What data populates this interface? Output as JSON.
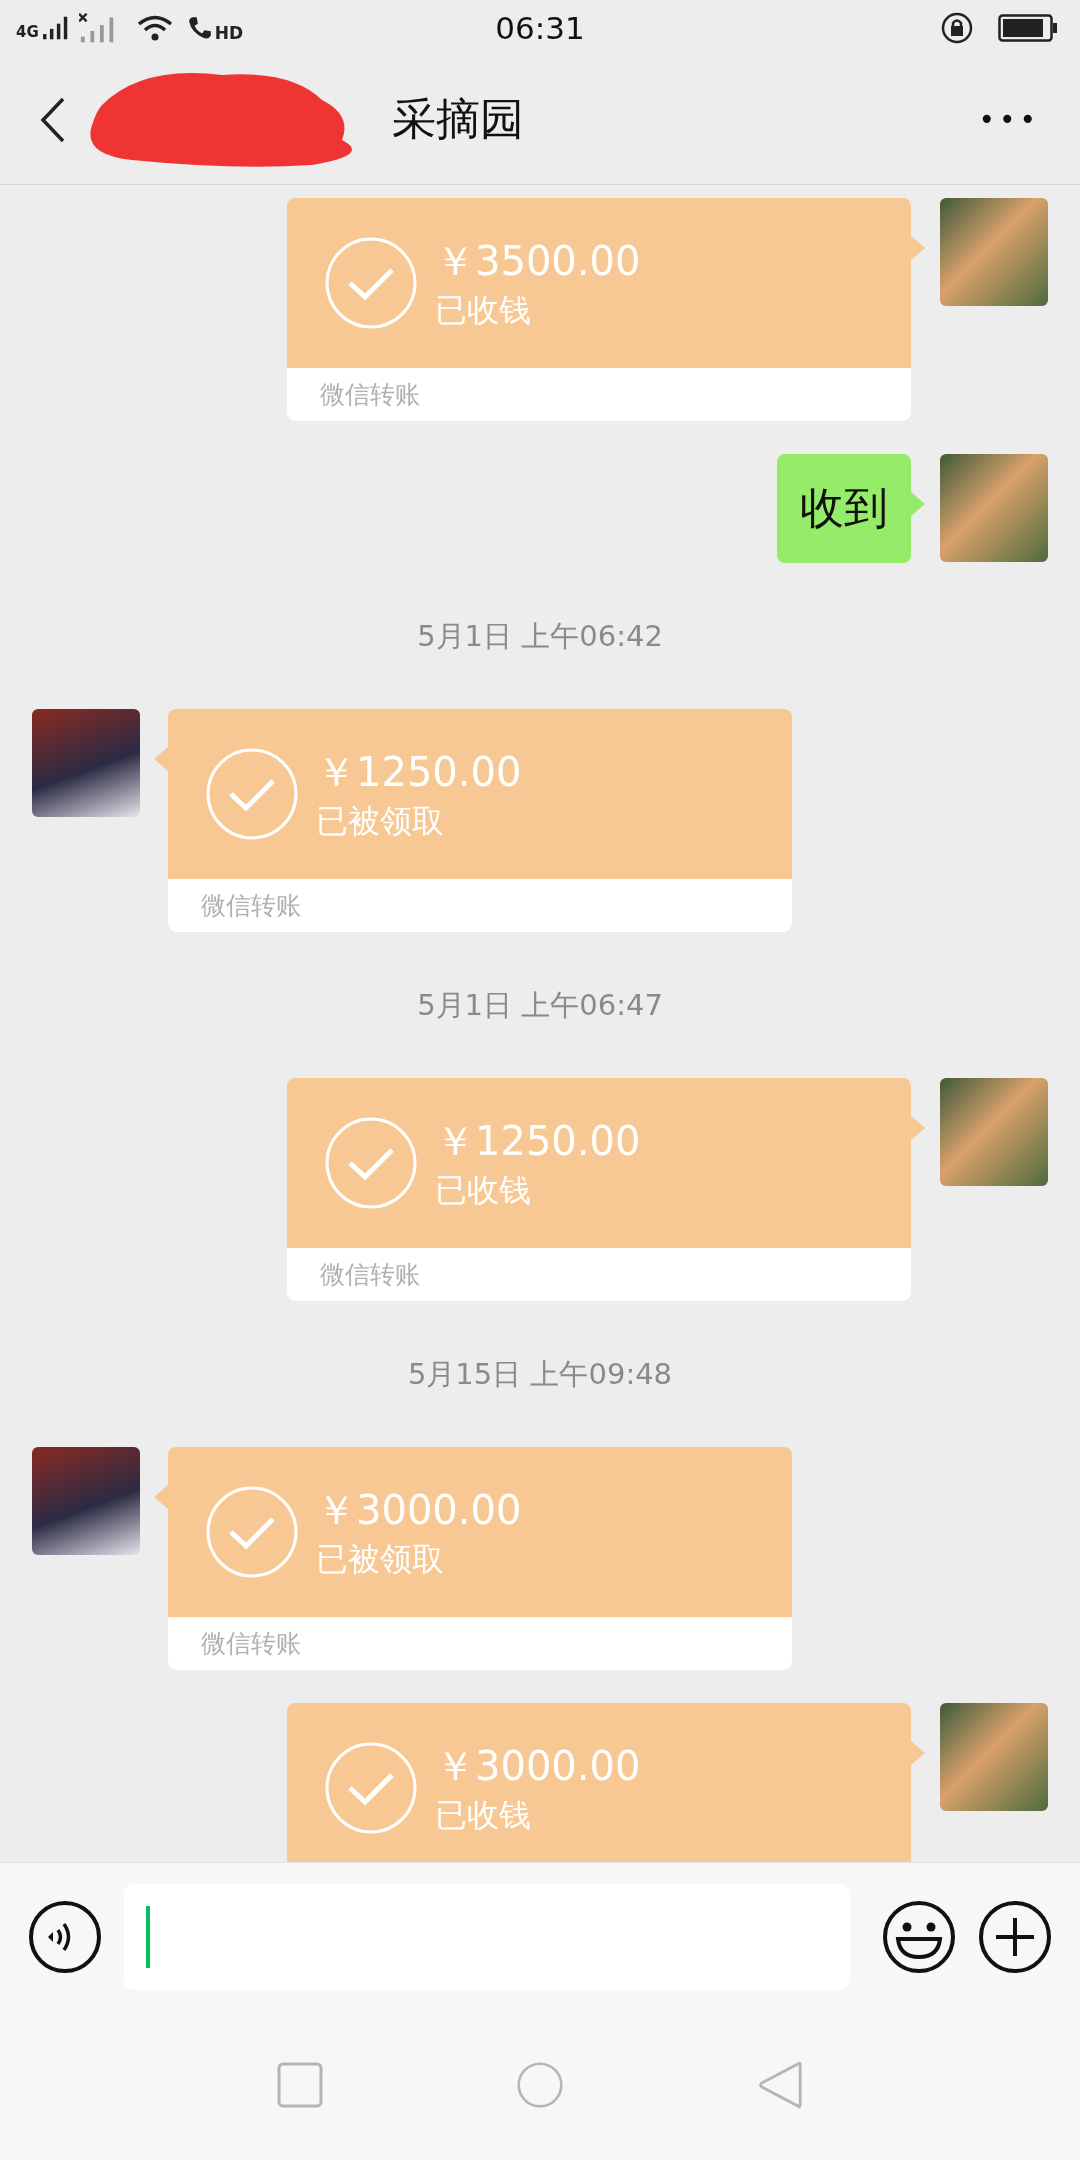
{
  "status_bar": {
    "network": "4G",
    "call": "HD",
    "time": "06:31"
  },
  "header": {
    "title": "采摘园",
    "redacted": true,
    "menu": "•••"
  },
  "messages": [
    {
      "kind": "sent_transfer",
      "amount": "￥3500.00",
      "status": "已收钱",
      "footer": "微信转账"
    },
    {
      "kind": "sent_text",
      "text": "收到"
    },
    {
      "kind": "time",
      "text": "5月1日 上午06:42"
    },
    {
      "kind": "received_transfer",
      "amount": "￥1250.00",
      "status": "已被领取",
      "footer": "微信转账"
    },
    {
      "kind": "time",
      "text": "5月1日 上午06:47"
    },
    {
      "kind": "sent_transfer",
      "amount": "￥1250.00",
      "status": "已收钱",
      "footer": "微信转账"
    },
    {
      "kind": "time",
      "text": "5月15日 上午09:48"
    },
    {
      "kind": "received_transfer",
      "amount": "￥3000.00",
      "status": "已被领取",
      "footer": "微信转账"
    },
    {
      "kind": "sent_transfer",
      "amount": "￥3000.00",
      "status": "已收钱"
    }
  ]
}
